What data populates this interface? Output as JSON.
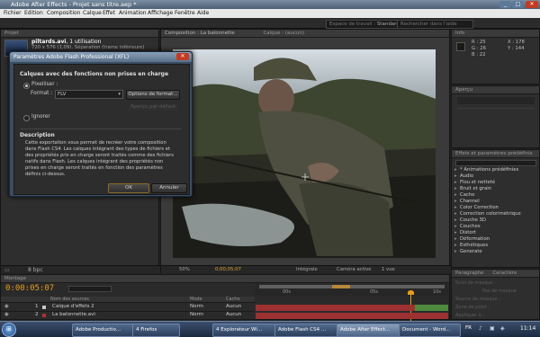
{
  "window": {
    "title": "Adobe After Effects - Projet sans titre.aep *"
  },
  "menu": [
    "Fichier",
    "Edition",
    "Composition",
    "Calque",
    "Effet",
    "Animation",
    "Affichage",
    "Fenêtre",
    "Aide"
  ],
  "workspace": {
    "label": "Espace de travail :",
    "value": "Standard",
    "search_placeholder": "Rechercher dans l'aide"
  },
  "project": {
    "name": "piltards.avi",
    "usage": ", 1 utilisation",
    "info": "720 x 576 (1,09), Séparation (trame inférieure)",
    "bpc": "8 bpc"
  },
  "composition_tab": "Composition : La baïonnette",
  "layer_tab": "Calque : (aucun)",
  "dialog": {
    "title": "Paramètres Adobe Flash Professional (XFL)",
    "section_title": "Calques avec des fonctions non prises en charge",
    "rasterize_label": "Pixelliser :",
    "format_label": "Format :",
    "format_value": "FLV",
    "options_button": "Options de format...",
    "ignore_label": "Ignorer",
    "hidden_button": "Aperçu par défaut",
    "description_title": "Description",
    "description_text": "Cette exportation vous permet de recréer votre composition dans Flash CS4. Les calques intégrant des types de fichiers et des propriétés pris en charge seront traités comme des fichiers natifs dans Flash. Les calques intégrant des propriétés non prises en charge seront traités en fonction des paramètres définis ci-dessus.",
    "ok": "OK",
    "cancel": "Annuler"
  },
  "viewer_footer": {
    "zoom": "50%",
    "timecode": "0;00;05;07",
    "quality": "Intégrale",
    "camera": "Caméra active",
    "views": "1 vue"
  },
  "info_panel": {
    "r": "R : 25",
    "g": "G : 26",
    "b": "B : 22",
    "x": "X : 178",
    "y": "Y : 144"
  },
  "preview_panel": {
    "title": "Aperçu"
  },
  "right_panel": {
    "title": "Effets et paramètres prédéfinis"
  },
  "effects": [
    "* Animations prédéfinies",
    "Audio",
    "Flou et netteté",
    "Bruit et grain",
    "Cache",
    "Channel",
    "Color Correction",
    "Correction colorimétrique",
    "Couche 3D",
    "Couches",
    "Distort",
    "Déformation",
    "Esthétiques",
    "Generate"
  ],
  "timeline": {
    "timecode": "0:00:05:07",
    "col_source": "Nom des sources",
    "col_mode": "Mode",
    "col_cache": "Cache",
    "layers": [
      {
        "num": "1",
        "name": "Calque d'effets 2",
        "mode": "Norm",
        "cache": "Aucun"
      },
      {
        "num": "2",
        "name": "La baïonnette.avi",
        "mode": "Norm",
        "cache": "Aucun"
      }
    ],
    "ruler": [
      "00s",
      "05s",
      "10s"
    ]
  },
  "paragraph_panel": {
    "tabs": [
      "Paragraphe",
      "Caractère"
    ],
    "lines": [
      "Suivi de masque :",
      "Pas de masque",
      "Source du masque :",
      "Zone de point :",
      "Appliquer à :"
    ]
  },
  "taskbar": {
    "start_tooltip": "Démarrer",
    "tasks": [
      "Adobe Productio...",
      "4 Firefox",
      "4 Explorateur Wi...",
      "Adobe Flash CS4 ...",
      "Adobe After Effect...",
      "Document - Word..."
    ],
    "lang": "FR",
    "clock": "11:14"
  },
  "colors": {
    "accent": "#e59e1c",
    "dialog_frame": "#3a4d63",
    "layer_bar": "#9c3131"
  }
}
